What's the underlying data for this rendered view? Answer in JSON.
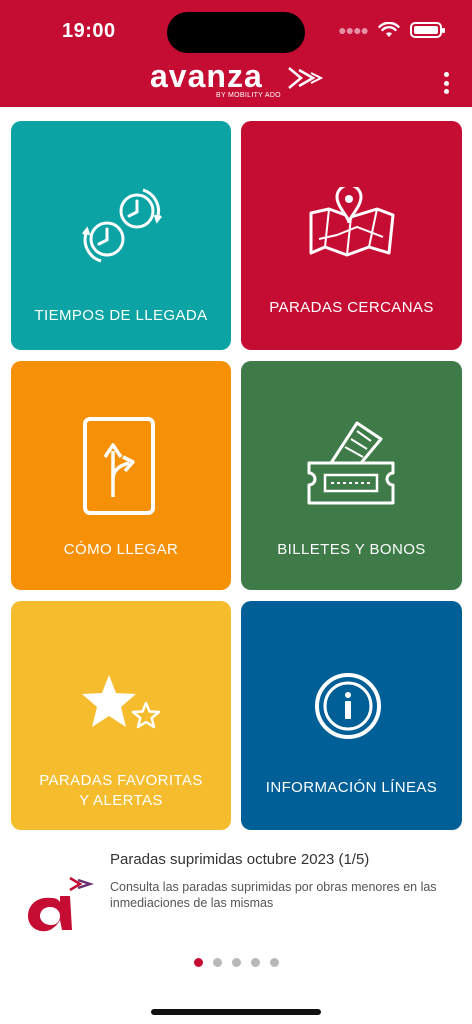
{
  "status_bar": {
    "time": "19:00"
  },
  "header": {
    "logo_text": "avanza",
    "logo_sub": "BY MOBILITY ADO"
  },
  "tiles": [
    {
      "label": "TIEMPOS DE LLEGADA",
      "color": "#0ba3a4",
      "icon": "clocks-icon"
    },
    {
      "label": "PARADAS CERCANAS",
      "color": "#c50d34",
      "icon": "map-pin-icon"
    },
    {
      "label": "CÓMO LLEGAR",
      "color": "#f69007",
      "icon": "directions-icon"
    },
    {
      "label": "BILLETES Y BONOS",
      "color": "#3f7b48",
      "icon": "ticket-icon"
    },
    {
      "label_line1": "PARADAS FAVORITAS",
      "label_line2": "Y ALERTAS",
      "color": "#f5bc2e",
      "icon": "star-icon"
    },
    {
      "label": "INFORMACIÓN LÍNEAS",
      "color": "#005f96",
      "icon": "info-icon"
    }
  ],
  "news": {
    "title": "Paradas suprimidas octubre 2023 (1/5)",
    "body": "Consulta las paradas suprimidas por obras menores en las inmediaciones de las mismas"
  },
  "pager": {
    "total": 5,
    "active": 1
  }
}
